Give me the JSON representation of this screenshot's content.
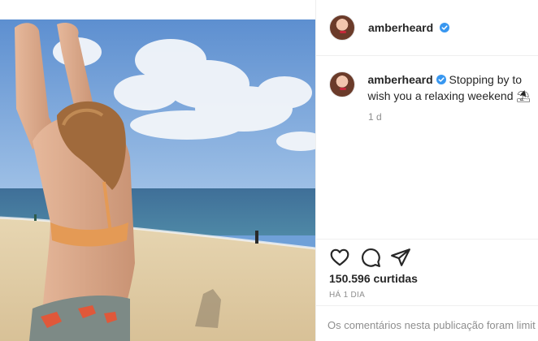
{
  "post": {
    "username": "amberheard",
    "caption": "Stopping by to wish you a relaxing weekend ⛱",
    "comment_age": "1 d",
    "likes": "150.596 curtidas",
    "post_age": "HÁ 1 DIA",
    "comments_disabled": "Os comentários nesta publicação foram limit"
  },
  "icons": {
    "verified": "verified-badge-icon",
    "like": "heart-icon",
    "comment": "comment-bubble-icon",
    "share": "paper-plane-icon"
  },
  "colors": {
    "verified": "#3897f0",
    "text": "#262626",
    "muted": "#8e8e8e",
    "divider": "#efefef"
  }
}
